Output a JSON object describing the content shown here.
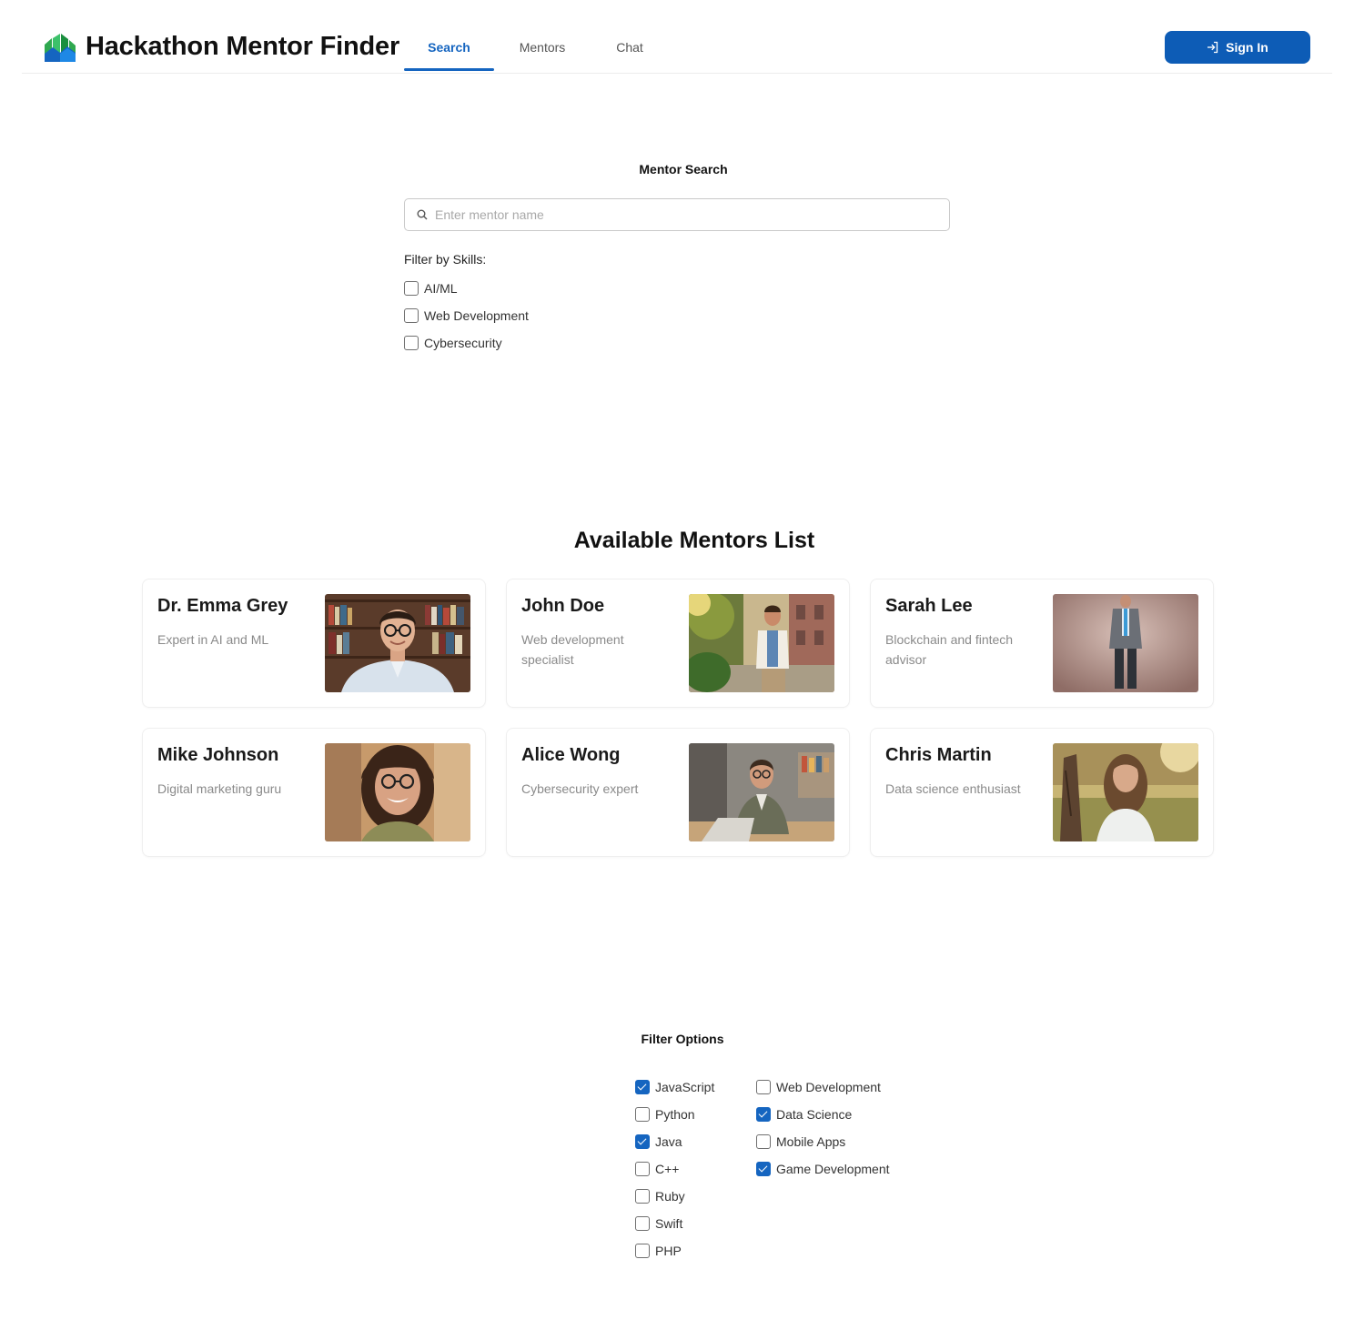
{
  "header": {
    "title": "Hackathon Mentor Finder",
    "logo_icon": "house-chart-icon",
    "tabs": [
      {
        "label": "Search",
        "active": true
      },
      {
        "label": "Mentors",
        "active": false
      },
      {
        "label": "Chat",
        "active": false
      }
    ],
    "signin_label": "Sign In",
    "signin_icon": "sign-in-icon",
    "accent_color": "#1565c0"
  },
  "search": {
    "title": "Mentor Search",
    "placeholder": "Enter mentor name",
    "value": "",
    "filter_label": "Filter by Skills:",
    "skills": [
      {
        "label": "AI/ML",
        "checked": false
      },
      {
        "label": "Web Development",
        "checked": false
      },
      {
        "label": "Cybersecurity",
        "checked": false
      }
    ]
  },
  "mentors": {
    "title": "Available Mentors List",
    "items": [
      {
        "name": "Dr. Emma Grey",
        "description": "Expert in AI and ML",
        "photo": "photo-man-library"
      },
      {
        "name": "John Doe",
        "description": "Web development specialist",
        "photo": "photo-man-street"
      },
      {
        "name": "Sarah Lee",
        "description": "Blockchain and fintech advisor",
        "photo": "photo-man-suit-studio"
      },
      {
        "name": "Mike Johnson",
        "description": "Digital marketing guru",
        "photo": "photo-woman-glasses"
      },
      {
        "name": "Alice Wong",
        "description": "Cybersecurity expert",
        "photo": "photo-man-laptop"
      },
      {
        "name": "Chris Martin",
        "description": "Data science enthusiast",
        "photo": "photo-woman-field"
      }
    ]
  },
  "filters": {
    "title": "Filter Options",
    "languages": [
      {
        "label": "JavaScript",
        "checked": true
      },
      {
        "label": "Python",
        "checked": false
      },
      {
        "label": "Java",
        "checked": true
      },
      {
        "label": "C++",
        "checked": false
      },
      {
        "label": "Ruby",
        "checked": false
      },
      {
        "label": "Swift",
        "checked": false
      },
      {
        "label": "PHP",
        "checked": false
      }
    ],
    "areas": [
      {
        "label": "Web Development",
        "checked": false
      },
      {
        "label": "Data Science",
        "checked": true
      },
      {
        "label": "Mobile Apps",
        "checked": false
      },
      {
        "label": "Game Development",
        "checked": true
      }
    ]
  }
}
